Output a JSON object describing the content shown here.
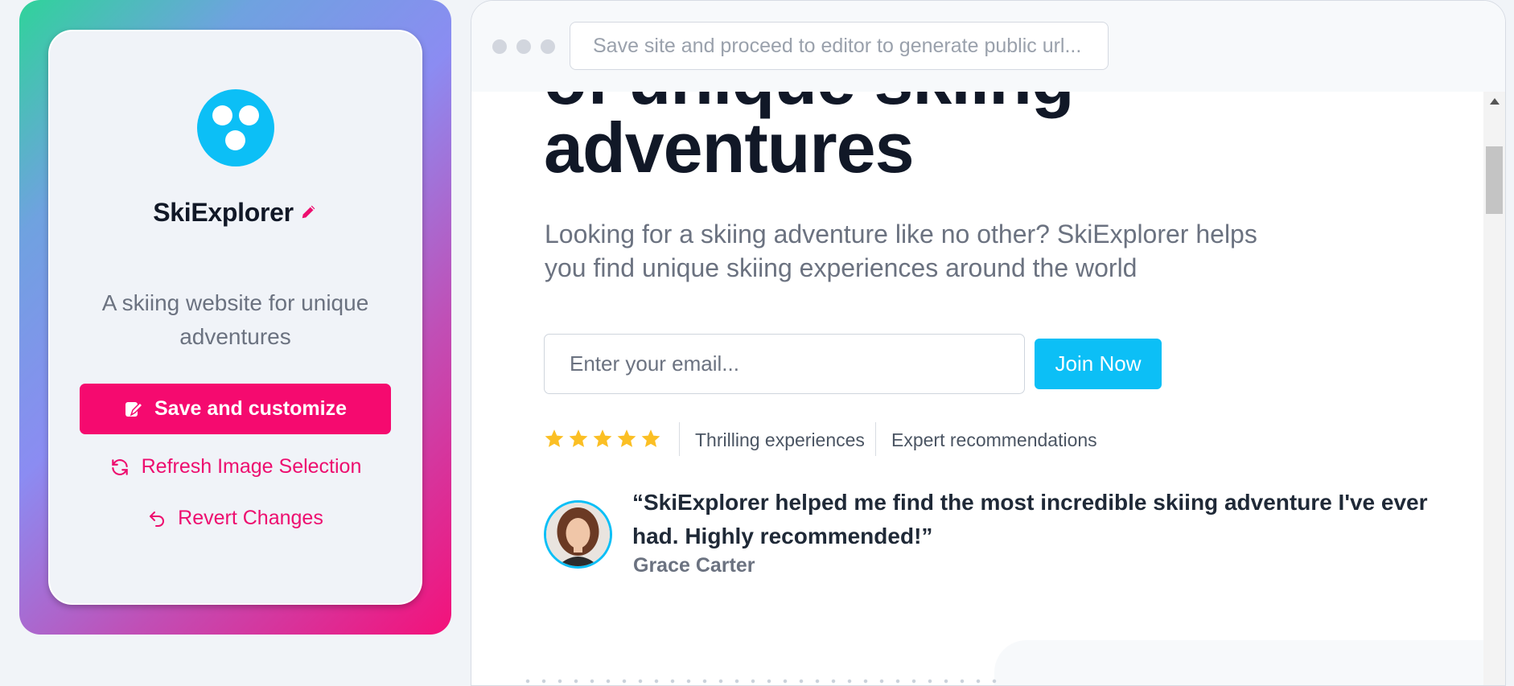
{
  "sidebar": {
    "site_name": "SkiExplorer",
    "tagline": "A skiing website for unique adventures",
    "save_label": "Save and customize",
    "refresh_label": "Refresh Image Selection",
    "revert_label": "Revert Changes"
  },
  "browser": {
    "url_placeholder": "Save site and proceed to editor to generate public url..."
  },
  "hero": {
    "title": "of unique skiing adventures",
    "subtitle": "Looking for a skiing adventure like no other? SkiExplorer helps you find unique skiing experiences around the world",
    "email_placeholder": "Enter your email...",
    "join_label": "Join Now",
    "rating_stars": 5,
    "features": [
      "Thrilling experiences",
      "Expert recommendations"
    ]
  },
  "testimonial": {
    "quote": "“SkiExplorer helped me find the most incredible skiing adventure I've ever had. Highly recommended!”",
    "author": "Grace Carter"
  },
  "colors": {
    "accent_pink": "#f50a6f",
    "accent_cyan": "#0cbff6",
    "star": "#fbbf24"
  }
}
